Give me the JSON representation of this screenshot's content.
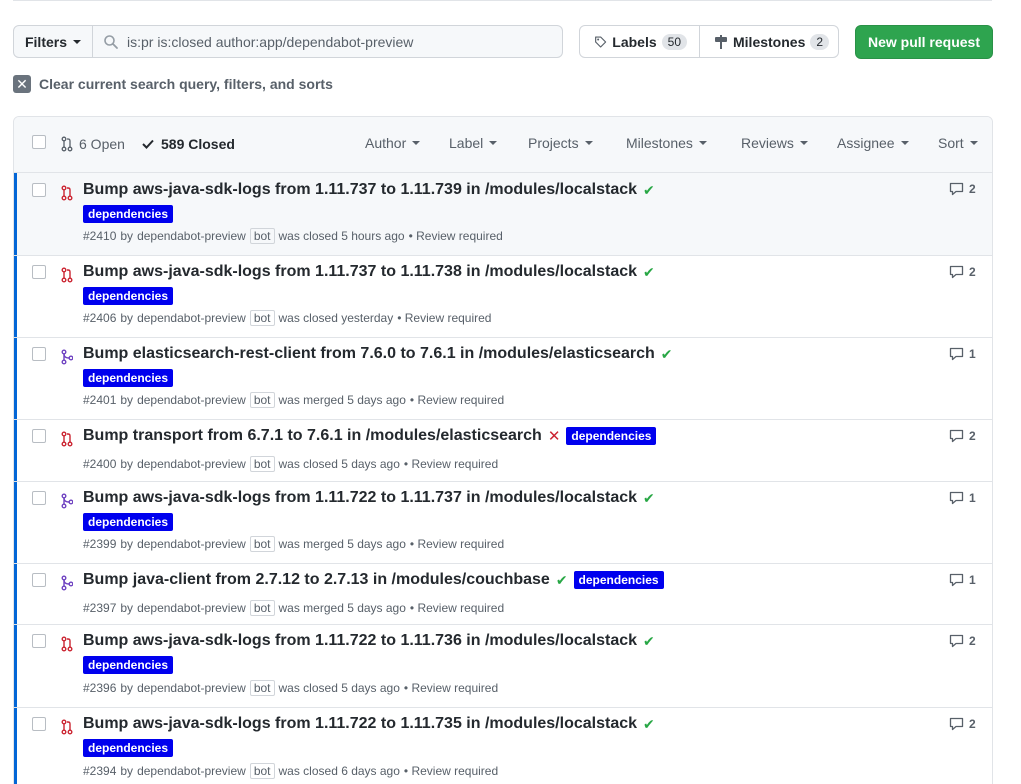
{
  "toolbar": {
    "filters_label": "Filters",
    "search_value": "is:pr is:closed author:app/dependabot-preview",
    "labels_label": "Labels",
    "labels_count": "50",
    "milestones_label": "Milestones",
    "milestones_count": "2",
    "new_pr_label": "New pull request",
    "clear_label": "Clear current search query, filters, and sorts"
  },
  "header": {
    "open_label": "6 Open",
    "closed_label": "589 Closed",
    "menus": [
      "Author",
      "Label",
      "Projects",
      "Milestones",
      "Reviews",
      "Assignee",
      "Sort"
    ]
  },
  "colors": {
    "closed": "#cb2431",
    "merged": "#6f42c1",
    "success": "#28a745",
    "label_bg": "#0000ee",
    "accent": "#0366d6",
    "primary_button": "#2ea44f"
  },
  "pull_requests": [
    {
      "title": "Bump aws-java-sdk-logs from 1.11.737 to 1.11.739 in /modules/localstack",
      "state": "closed",
      "status": "check",
      "label": "dependencies",
      "number": "#2410",
      "by": "by",
      "author": "dependabot-preview",
      "bot": "bot",
      "action": "was closed 5 hours ago",
      "review": "• Review required",
      "comments": "2"
    },
    {
      "title": "Bump aws-java-sdk-logs from 1.11.737 to 1.11.738 in /modules/localstack",
      "state": "closed",
      "status": "check",
      "label": "dependencies",
      "number": "#2406",
      "by": "by",
      "author": "dependabot-preview",
      "bot": "bot",
      "action": "was closed yesterday",
      "review": "• Review required",
      "comments": "2"
    },
    {
      "title": "Bump elasticsearch-rest-client from 7.6.0 to 7.6.1 in /modules/elasticsearch",
      "state": "merged",
      "status": "check",
      "label": "dependencies",
      "number": "#2401",
      "by": "by",
      "author": "dependabot-preview",
      "bot": "bot",
      "action": "was merged 5 days ago",
      "review": "• Review required",
      "comments": "1"
    },
    {
      "title": "Bump transport from 6.7.1 to 7.6.1 in /modules/elasticsearch",
      "state": "closed",
      "status": "x",
      "label": "dependencies",
      "number": "#2400",
      "by": "by",
      "author": "dependabot-preview",
      "bot": "bot",
      "action": "was closed 5 days ago",
      "review": "• Review required",
      "comments": "2"
    },
    {
      "title": "Bump aws-java-sdk-logs from 1.11.722 to 1.11.737 in /modules/localstack",
      "state": "merged",
      "status": "check",
      "label": "dependencies",
      "number": "#2399",
      "by": "by",
      "author": "dependabot-preview",
      "bot": "bot",
      "action": "was merged 5 days ago",
      "review": "• Review required",
      "comments": "1"
    },
    {
      "title": "Bump java-client from 2.7.12 to 2.7.13 in /modules/couchbase",
      "state": "merged",
      "status": "check",
      "label": "dependencies",
      "number": "#2397",
      "by": "by",
      "author": "dependabot-preview",
      "bot": "bot",
      "action": "was merged 5 days ago",
      "review": "• Review required",
      "comments": "1"
    },
    {
      "title": "Bump aws-java-sdk-logs from 1.11.722 to 1.11.736 in /modules/localstack",
      "state": "closed",
      "status": "check",
      "label": "dependencies",
      "number": "#2396",
      "by": "by",
      "author": "dependabot-preview",
      "bot": "bot",
      "action": "was closed 5 days ago",
      "review": "• Review required",
      "comments": "2"
    },
    {
      "title": "Bump aws-java-sdk-logs from 1.11.722 to 1.11.735 in /modules/localstack",
      "state": "closed",
      "status": "check",
      "label": "dependencies",
      "number": "#2394",
      "by": "by",
      "author": "dependabot-preview",
      "bot": "bot",
      "action": "was closed 6 days ago",
      "review": "• Review required",
      "comments": "2"
    }
  ]
}
